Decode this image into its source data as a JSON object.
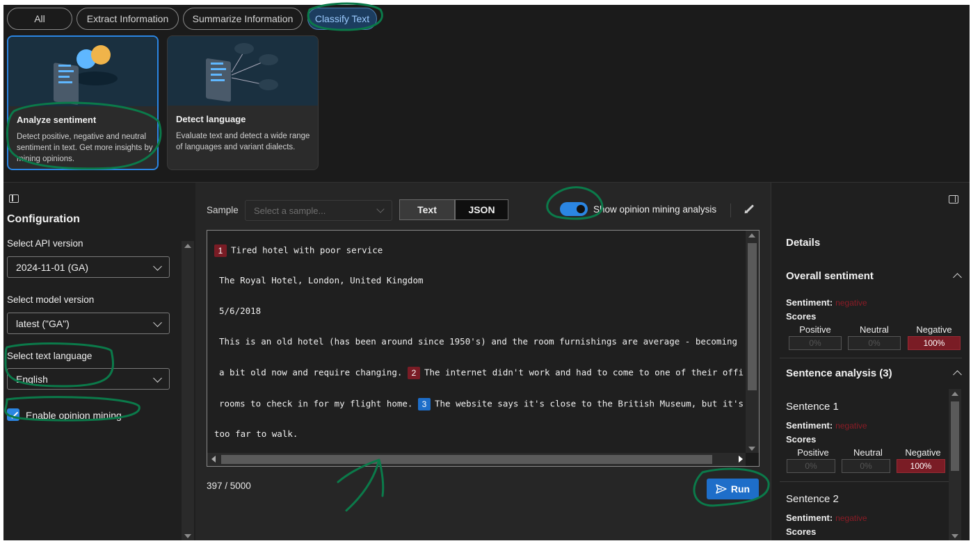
{
  "filters": [
    {
      "label": "All"
    },
    {
      "label": "Extract Information"
    },
    {
      "label": "Summarize Information"
    },
    {
      "label": "Classify Text",
      "active": true
    }
  ],
  "cards": [
    {
      "title": "Analyze sentiment",
      "desc": "Detect positive, negative and neutral sentiment in text. Get more insights by mining opinions.",
      "selected": true
    },
    {
      "title": "Detect language",
      "desc": "Evaluate text and detect a wide range of languages and variant dialects."
    }
  ],
  "config": {
    "title": "Configuration",
    "api_label": "Select API version",
    "api_value": "2024-11-01 (GA)",
    "model_label": "Select model version",
    "model_value": "latest (\"GA\")",
    "lang_label": "Select text language",
    "lang_value": "English",
    "opinion_label": "Enable opinion mining",
    "opinion_checked": true
  },
  "editor": {
    "sample_label": "Sample",
    "sample_placeholder": "Select a sample...",
    "tab_text": "Text",
    "tab_json": "JSON",
    "toggle_label": "Show opinion mining analysis",
    "toggle_on": true,
    "lines": [
      {
        "num": "1",
        "num_color": "red",
        "text": "Tired hotel with poor service"
      },
      {
        "text": "The Royal Hotel, London, United Kingdom"
      },
      {
        "text": "5/6/2018"
      },
      {
        "text": "This is an old hotel (has been around since 1950's) and the room furnishings are average - becoming"
      },
      {
        "pre": "a bit old now and require changing.",
        "num": "2",
        "num_color": "red",
        "text": "The internet didn't work and had to come to one of their offi"
      },
      {
        "pre": "rooms to check in for my flight home.",
        "num": "3",
        "num_color": "blue",
        "text": "The website says it's close to the British Museum, but it's"
      },
      {
        "text": "too far to walk."
      }
    ],
    "char_count": "397 / 5000",
    "run_label": "Run"
  },
  "details": {
    "title": "Details",
    "overall_title": "Overall sentiment",
    "sentiment_label": "Sentiment:",
    "sentiment_value": "negative",
    "scores_label": "Scores",
    "positive_label": "Positive",
    "neutral_label": "Neutral",
    "negative_label": "Negative",
    "overall_scores": {
      "positive": "0%",
      "neutral": "0%",
      "negative": "100%"
    },
    "sentence_title": "Sentence analysis (3)",
    "sentence1_title": "Sentence 1",
    "sentence1_scores": {
      "positive": "0%",
      "neutral": "0%",
      "negative": "100%"
    },
    "sentence2_title": "Sentence 2"
  },
  "colors": {
    "accent": "#2b86e3",
    "negative": "#7a1c25",
    "annotation": "#0b7a4a"
  }
}
